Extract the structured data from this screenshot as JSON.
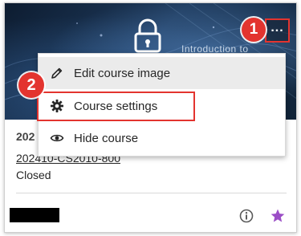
{
  "banner": {
    "caption": "Introduction to"
  },
  "badges": {
    "first": "1",
    "second": "2"
  },
  "menu": {
    "items": [
      {
        "label": "Edit course image",
        "icon": "pencil-icon"
      },
      {
        "label": "Course settings",
        "icon": "gear-icon"
      },
      {
        "label": "Hide course",
        "icon": "eye-icon"
      }
    ]
  },
  "course": {
    "term": "202",
    "id": "202410-CS2010-800",
    "status": "Closed"
  },
  "colors": {
    "callout_red": "#e3342f",
    "favorite_purple": "#9b4ec6"
  },
  "icons": {
    "more": "more-options-icon",
    "info": "info-icon",
    "favorite": "star-icon"
  }
}
